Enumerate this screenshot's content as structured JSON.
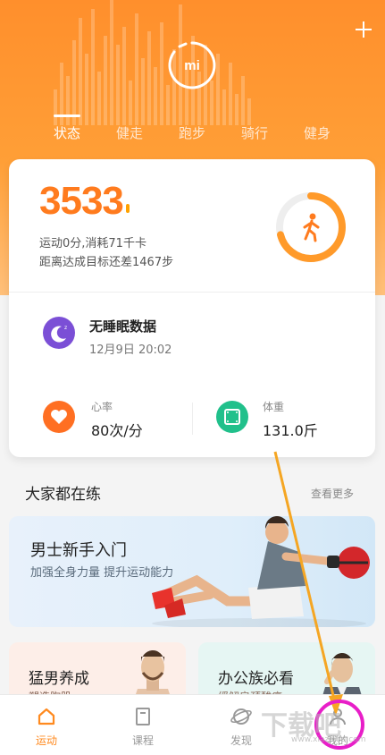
{
  "header": {
    "add_icon": "plus-icon",
    "logo_text": "mi",
    "tabs": [
      {
        "label": "状态",
        "active": true
      },
      {
        "label": "健走",
        "active": false
      },
      {
        "label": "跑步",
        "active": false
      },
      {
        "label": "骑行",
        "active": false
      },
      {
        "label": "健身",
        "active": false
      }
    ]
  },
  "status_card": {
    "steps": "3533",
    "activity_line": "运动0分,消耗71千卡",
    "goal_line": "距离达成目标还差1467步",
    "goal_progress": 0.71,
    "sleep": {
      "title": "无睡眠数据",
      "time": "12月9日  20:02"
    },
    "heart_rate": {
      "label": "心率",
      "value": "80次/分"
    },
    "weight": {
      "label": "体重",
      "value": "131.0斤"
    }
  },
  "section": {
    "title": "大家都在练",
    "more": "查看更多"
  },
  "courses": {
    "featured": {
      "title": "男士新手入门",
      "subtitle": "加强全身力量 提升运动能力"
    },
    "left": {
      "title": "猛男养成",
      "subtitle": "塑造胸肌"
    },
    "right": {
      "title": "办公族必看",
      "subtitle": "缓解肩颈酸痛"
    }
  },
  "bottom_nav": [
    {
      "label": "运动",
      "active": true
    },
    {
      "label": "课程",
      "active": false
    },
    {
      "label": "发现",
      "active": false
    },
    {
      "label": "我的",
      "active": false
    }
  ],
  "watermark": {
    "main": "下载吧",
    "sub": "www.xiazaiba.com"
  },
  "colors": {
    "accent": "#ff8a1f",
    "sleep": "#7b4fd6",
    "heart": "#ff6f22",
    "weight": "#21c08b"
  }
}
